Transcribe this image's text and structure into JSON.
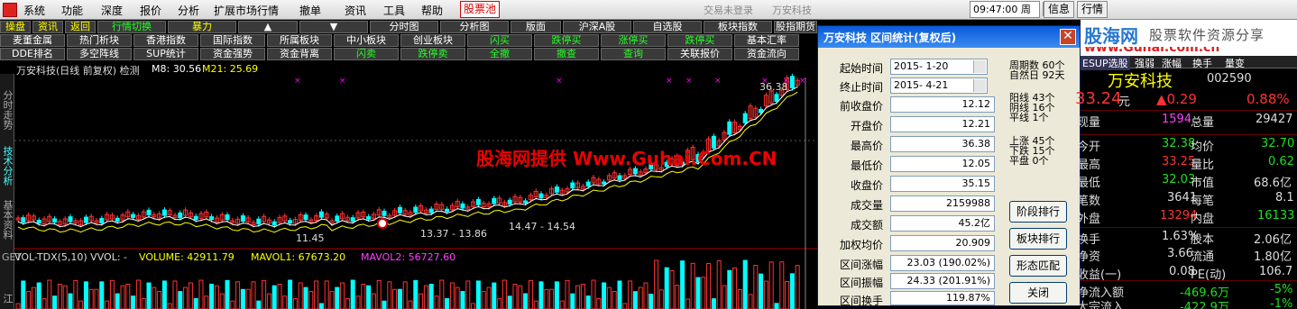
{
  "menu": {
    "items": [
      "系统",
      "功能",
      "深度",
      "报价",
      "分析",
      "扩展市场行情",
      "撤单",
      "资讯",
      "工具",
      "帮助"
    ],
    "active_item": "股票池",
    "trade_status": "交易未登录",
    "stock_name": "万安科技",
    "clock": "09:47:00 周六",
    "right_buttons": [
      "信息",
      "行情"
    ]
  },
  "toolbar1": {
    "buttons": [
      "操盘",
      "资讯",
      "返回",
      "行情切换",
      "暴力",
      "▲",
      "▼",
      "分时图",
      "分析图",
      "版面",
      "沪深A股",
      "自选股",
      "板块指数",
      "股指期货"
    ]
  },
  "toolbar2": {
    "buttons": [
      "麦董金属",
      "热门析块",
      "香港指数",
      "国际指数",
      "所属板块",
      "中小板块",
      "创业板块",
      "闪买",
      "跌停买",
      "涨停买",
      "跌停买",
      "基本汇率"
    ]
  },
  "toolbar3": {
    "buttons": [
      "DDE排名",
      "多空阵线",
      "SUP统计",
      "资金强势",
      "资金背离",
      "闪卖",
      "跌停卖",
      "全撤",
      "撤查",
      "查询",
      "关联报价",
      "资金流向"
    ]
  },
  "vtabs": [
    "分时走势",
    "技术分析",
    "基本资料",
    "GET",
    "江"
  ],
  "chart": {
    "header_title": "万安科技(日线 前复权) 检测",
    "ma_labels": [
      {
        "text": "M8: 30.56",
        "color": "#ffffff"
      },
      {
        "text": "M21: 25.69",
        "color": "#ffff00"
      }
    ],
    "price_labels": {
      "high": "36.38",
      "low1": "11.45",
      "range1": "13.37 - 13.86",
      "range2": "14.47 - 14.54"
    },
    "volume_header": "VOL-TDX(5,10)  VVOL: -",
    "volume_values": [
      {
        "text": "VOLUME: 42911.79",
        "color": "#ffff00"
      },
      {
        "text": "MAVOL1: 67673.20",
        "color": "#ffff00"
      },
      {
        "text": "MAVOL2: 56727.60",
        "color": "#ff40ff"
      }
    ],
    "colors": {
      "up": "#ff3232",
      "down": "#00ffff",
      "ma8": "#ffffff",
      "ma21": "#ffff00"
    }
  },
  "watermark": "股海网提供 Www.Guhai.Com.CN",
  "dialog": {
    "title": "万安科技  区间统计(复权后)",
    "start_time_label": "起始时间",
    "start_time": "2015- 1-20",
    "end_time_label": "终止时间",
    "end_time": "2015- 4-21",
    "fields": [
      {
        "label": "前收盘价",
        "value": "12.12"
      },
      {
        "label": "开盘价",
        "value": "12.21"
      },
      {
        "label": "最高价",
        "value": "36.38"
      },
      {
        "label": "最低价",
        "value": "12.05"
      },
      {
        "label": "收盘价",
        "value": "35.15"
      },
      {
        "label": "成交量",
        "value": "2159988"
      },
      {
        "label": "成交额",
        "value": "45.2亿"
      },
      {
        "label": "加权均价",
        "value": "20.909"
      },
      {
        "label": "区间涨幅",
        "value": "23.03 (190.02%)"
      },
      {
        "label": "区间振幅",
        "value": "24.33 (201.91%)"
      },
      {
        "label": "区间换手",
        "value": "119.87%"
      }
    ],
    "stats": {
      "period_days": "周期数  60个",
      "natural_days": "自然日  92天",
      "yang": "阳线  43个",
      "yin": "阴线  16个",
      "flat_line": "平线  1个",
      "up": "上涨  45个",
      "down": "下跌  15个",
      "flat": "平盘  0个"
    },
    "buttons": [
      "阶段排行",
      "板块排行",
      "形态匹配",
      "关闭"
    ]
  },
  "right_panel": {
    "site_name": "股海网",
    "site_slogan": "股票软件资源分享",
    "site_url": "www.Guhai.com.cn",
    "tabs": [
      "ESUP选股",
      "强弱",
      "涨幅",
      "换手",
      "量变"
    ],
    "stock_name": "万安科技",
    "stock_code": "002590",
    "price": "33.24",
    "price_unit": "元",
    "change": "▲0.29",
    "change_pct": "0.88%",
    "rows": [
      {
        "l1": "现量",
        "v1": "1594",
        "c1": "magenta",
        "l2": "总量",
        "v2": "29427",
        "c2": "white"
      },
      {
        "l1": "今开",
        "v1": "32.38",
        "c1": "green",
        "l2": "均价",
        "v2": "32.70",
        "c2": "green"
      },
      {
        "l1": "最高",
        "v1": "33.25",
        "c1": "red",
        "l2": "量比",
        "v2": "0.62",
        "c2": "green"
      },
      {
        "l1": "最低",
        "v1": "32.03",
        "c1": "green",
        "l2": "市值",
        "v2": "68.6亿",
        "c2": "white"
      },
      {
        "l1": "笔数",
        "v1": "3641",
        "c1": "white",
        "l2": "每笔",
        "v2": "8.1",
        "c2": "white"
      },
      {
        "l1": "外盘",
        "v1": "13294",
        "c1": "red",
        "l2": "内盘",
        "v2": "16133",
        "c2": "green"
      },
      {
        "l1": "换手",
        "v1": "1.63%",
        "c1": "white",
        "l2": "股本",
        "v2": "2.06亿",
        "c2": "white"
      },
      {
        "l1": "净资",
        "v1": "3.66",
        "c1": "white",
        "l2": "流通",
        "v2": "1.80亿",
        "c2": "white"
      },
      {
        "l1": "收益(一)",
        "v1": "0.08",
        "c1": "white",
        "l2": "PE(动)",
        "v2": "106.7",
        "c2": "white"
      },
      {
        "l1": "净流入额",
        "v1": "-469.6万",
        "c1": "green",
        "l2": "",
        "v2": "-5%",
        "c2": "green"
      },
      {
        "l1": "大宗流入",
        "v1": "-422.9万",
        "c1": "green",
        "l2": "",
        "v2": "-1%",
        "c2": "green"
      }
    ]
  }
}
